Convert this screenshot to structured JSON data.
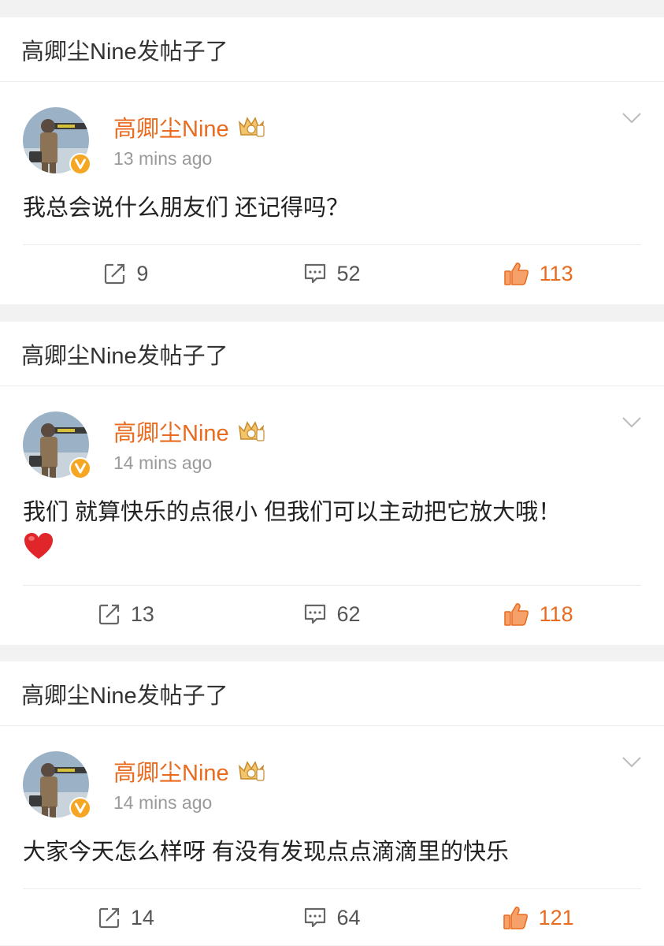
{
  "posts": [
    {
      "header": "高卿尘Nine发帖子了",
      "username": "高卿尘Nine",
      "time": "13 mins ago",
      "text": "我总会说什么朋友们 还记得吗？",
      "has_heart": false,
      "reposts": "9",
      "comments": "52",
      "likes": "113"
    },
    {
      "header": "高卿尘Nine发帖子了",
      "username": "高卿尘Nine",
      "time": "14 mins ago",
      "text": "我们 就算快乐的点很小 但我们可以主动把它放大哦！",
      "has_heart": true,
      "reposts": "13",
      "comments": "62",
      "likes": "118"
    },
    {
      "header": "高卿尘Nine发帖子了",
      "username": "高卿尘Nine",
      "time": "14 mins ago",
      "text": "大家今天怎么样呀 有没有发现点点滴滴里的快乐",
      "has_heart": false,
      "reposts": "14",
      "comments": "64",
      "likes": "121"
    }
  ],
  "icons": {
    "repost": "repost-icon",
    "comment": "comment-icon",
    "like": "thumbs-up-icon",
    "menu": "chevron-down-icon",
    "verified": "verified-v-icon",
    "vip": "crown-badge-icon",
    "heart": "red-heart-emoji"
  },
  "colors": {
    "accent": "#e86b1f",
    "background": "#f2f2f2",
    "card": "#ffffff",
    "verified": "#f5a623"
  }
}
